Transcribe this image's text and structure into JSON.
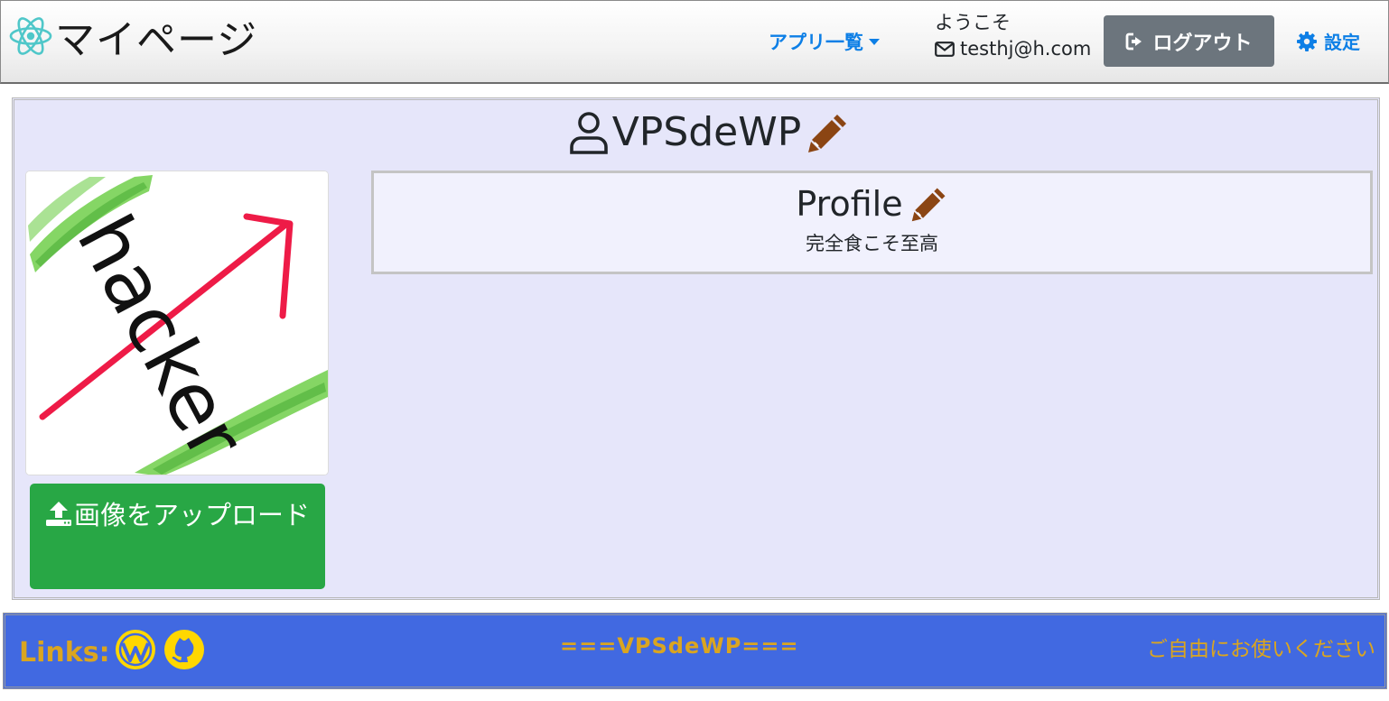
{
  "header": {
    "brand_title": "マイページ",
    "app_menu_label": "アプリ一覧",
    "welcome_text": "ようこそ",
    "user_email": "testhj@h.com",
    "logout_label": "ログアウト",
    "settings_label": "設定"
  },
  "profile": {
    "username": "VPSdeWP",
    "section_title": "Profile",
    "bio": "完全食こそ至高",
    "upload_button_label": "画像をアップロード",
    "avatar_text": "hacker"
  },
  "footer": {
    "links_label": "Links:",
    "center_text": "===VPSdeWP===",
    "right_text": "ご自由にお使いください"
  },
  "icons": {
    "brand": "react-atom-icon",
    "email": "envelope-icon",
    "logout": "sign-out-icon",
    "settings": "gear-icon",
    "user": "user-icon",
    "edit": "pencil-icon",
    "upload": "upload-icon",
    "wordpress": "wordpress-icon",
    "github": "github-icon"
  },
  "colors": {
    "link_blue": "#0d7fe6",
    "logout_gray": "#6c757d",
    "main_bg": "#e6e6fa",
    "profile_bg": "#f1f1fd",
    "upload_green": "#28a745",
    "pencil_brown": "#8b4513",
    "footer_blue": "#4169e1",
    "footer_gold": "#daa520"
  }
}
